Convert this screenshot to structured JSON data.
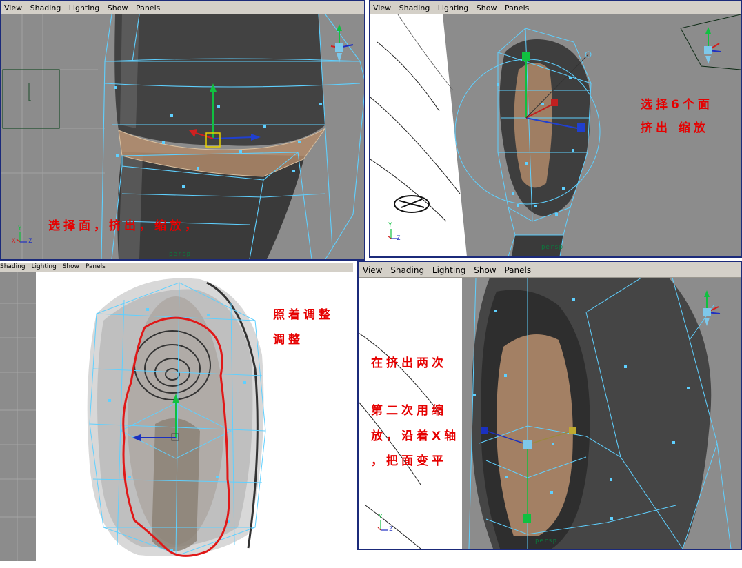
{
  "panels": [
    {
      "menu": [
        "View",
        "Shading",
        "Lighting",
        "Show",
        "Panels"
      ],
      "camera_label": "persp",
      "annotations": [
        "选择面，挤出，缩放，"
      ]
    },
    {
      "menu": [
        "View",
        "Shading",
        "Lighting",
        "Show",
        "Panels"
      ],
      "camera_label": "persp",
      "annotations": [
        "选择6个面",
        "挤出  缩放"
      ]
    },
    {
      "menu": [
        "Shading",
        "Lighting",
        "Show",
        "Panels"
      ],
      "annotations": [
        "照着调整",
        "调整"
      ]
    },
    {
      "menu": [
        "View",
        "Shading",
        "Lighting",
        "Show",
        "Panels"
      ],
      "camera_label": "persp",
      "annotations": [
        "在挤出两次",
        "第二次用缩",
        "放，沿着X轴",
        "，把面变平"
      ]
    }
  ],
  "axis_labels": {
    "x": "X",
    "y": "Y",
    "z": "Z"
  },
  "colors": {
    "viewport_bg": "#8f8f8f",
    "wireframe": "#5fd0ff",
    "mesh_dark": "#3d3d3d",
    "selected_face": "#b08a6a",
    "annotation": "#e60000",
    "panel_border": "#1b2a7a",
    "menubar": "#d4d0c8"
  },
  "icons": [
    "view-cube-icon",
    "move-manipulator-icon",
    "axis-indicator-icon"
  ]
}
